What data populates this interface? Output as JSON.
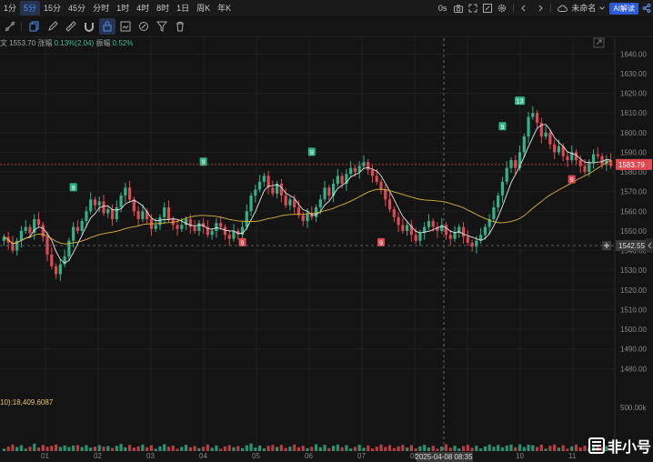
{
  "timeframes": [
    {
      "label": "1分",
      "active": false
    },
    {
      "label": "5分",
      "active": true
    },
    {
      "label": "15分",
      "active": false
    },
    {
      "label": "45分",
      "active": false
    },
    {
      "label": "分时",
      "active": false
    },
    {
      "label": "1时",
      "active": false
    },
    {
      "label": "4时",
      "active": false
    },
    {
      "label": "8时",
      "active": false
    },
    {
      "label": "1日",
      "active": false
    },
    {
      "label": "周K",
      "active": false
    },
    {
      "label": "年K",
      "active": false
    }
  ],
  "topright": {
    "countdown": "0s",
    "layout_name": "未命名",
    "ai_label": "AI解读"
  },
  "info": {
    "price_text": "文 1553.70",
    "change_label": "涨幅",
    "change_value": "0.13%(2.04)",
    "amp_label": "振幅",
    "amp_value": "0.52%"
  },
  "volume_text": "10):18,409.6087",
  "colors": {
    "up": "#2fb38a",
    "down": "#e0494f",
    "ma_fast": "#e6e6e6",
    "ma_slow": "#d9b43a",
    "accent": "#4f8ff7"
  },
  "chart_data": {
    "type": "candlestick",
    "ylim": [
      1457,
      1648
    ],
    "y_ticks": [
      "1640.00",
      "1630.00",
      "1620.00",
      "1610.00",
      "1600.00",
      "1590.00",
      "1580.00",
      "1570.00",
      "1560.00",
      "1550.00",
      "1540.00",
      "1530.00",
      "1520.00",
      "1510.00",
      "1500.00",
      "1490.00",
      "1480.00"
    ],
    "y_tick_values": [
      1640,
      1630,
      1620,
      1610,
      1600,
      1590,
      1580,
      1570,
      1560,
      1550,
      1540,
      1530,
      1520,
      1510,
      1500,
      1490,
      1480
    ],
    "volume_tick": "500.00k",
    "x_ticks": [
      "01",
      "02",
      "03",
      "04",
      "05",
      "06",
      "07",
      "08",
      "09",
      "10",
      "11"
    ],
    "crosshair_x_label": "2025-04-08 08:35",
    "crosshair_price": "1542.55",
    "crosshair_price_value": 1542.55,
    "last_price": "1583.79",
    "last_price_value": 1583.79,
    "close": [
      1547,
      1544,
      1540,
      1545,
      1550,
      1552,
      1549,
      1556,
      1553,
      1547,
      1538,
      1532,
      1528,
      1533,
      1537,
      1545,
      1552,
      1550,
      1555,
      1560,
      1566,
      1563,
      1565,
      1559,
      1561,
      1556,
      1562,
      1568,
      1572,
      1566,
      1560,
      1556,
      1560,
      1556,
      1551,
      1553,
      1557,
      1562,
      1556,
      1553,
      1551,
      1553,
      1556,
      1552,
      1550,
      1554,
      1552,
      1548,
      1550,
      1554,
      1552,
      1548,
      1546,
      1550,
      1548,
      1552,
      1560,
      1568,
      1571,
      1575,
      1578,
      1572,
      1569,
      1574,
      1568,
      1563,
      1566,
      1562,
      1558,
      1555,
      1559,
      1557,
      1562,
      1566,
      1572,
      1568,
      1574,
      1578,
      1574,
      1579,
      1582,
      1580,
      1583,
      1585,
      1581,
      1578,
      1575,
      1571,
      1566,
      1561,
      1557,
      1553,
      1550,
      1553,
      1548,
      1545,
      1549,
      1552,
      1555,
      1552,
      1550,
      1553,
      1548,
      1546,
      1549,
      1552,
      1547,
      1544,
      1542,
      1545,
      1548,
      1552,
      1556,
      1562,
      1568,
      1575,
      1582,
      1586,
      1582,
      1590,
      1598,
      1608,
      1610,
      1605,
      1598,
      1600,
      1594,
      1590,
      1593,
      1588,
      1586,
      1590,
      1586,
      1583,
      1580,
      1585,
      1589,
      1588,
      1584,
      1586,
      1583
    ],
    "markers": [
      {
        "label": "9",
        "kind": "up",
        "index": 16,
        "price": 1572
      },
      {
        "label": "9",
        "kind": "up",
        "index": 46,
        "price": 1585
      },
      {
        "label": "9",
        "kind": "up",
        "index": 71,
        "price": 1590
      },
      {
        "label": "13",
        "kind": "up",
        "index": 119,
        "price": 1616
      },
      {
        "label": "9",
        "kind": "up",
        "index": 115,
        "price": 1603
      },
      {
        "label": "9",
        "kind": "down",
        "index": 55,
        "price": 1544
      },
      {
        "label": "9",
        "kind": "down",
        "index": 87,
        "price": 1544
      },
      {
        "label": "9",
        "kind": "down",
        "index": 131,
        "price": 1576
      }
    ]
  }
}
